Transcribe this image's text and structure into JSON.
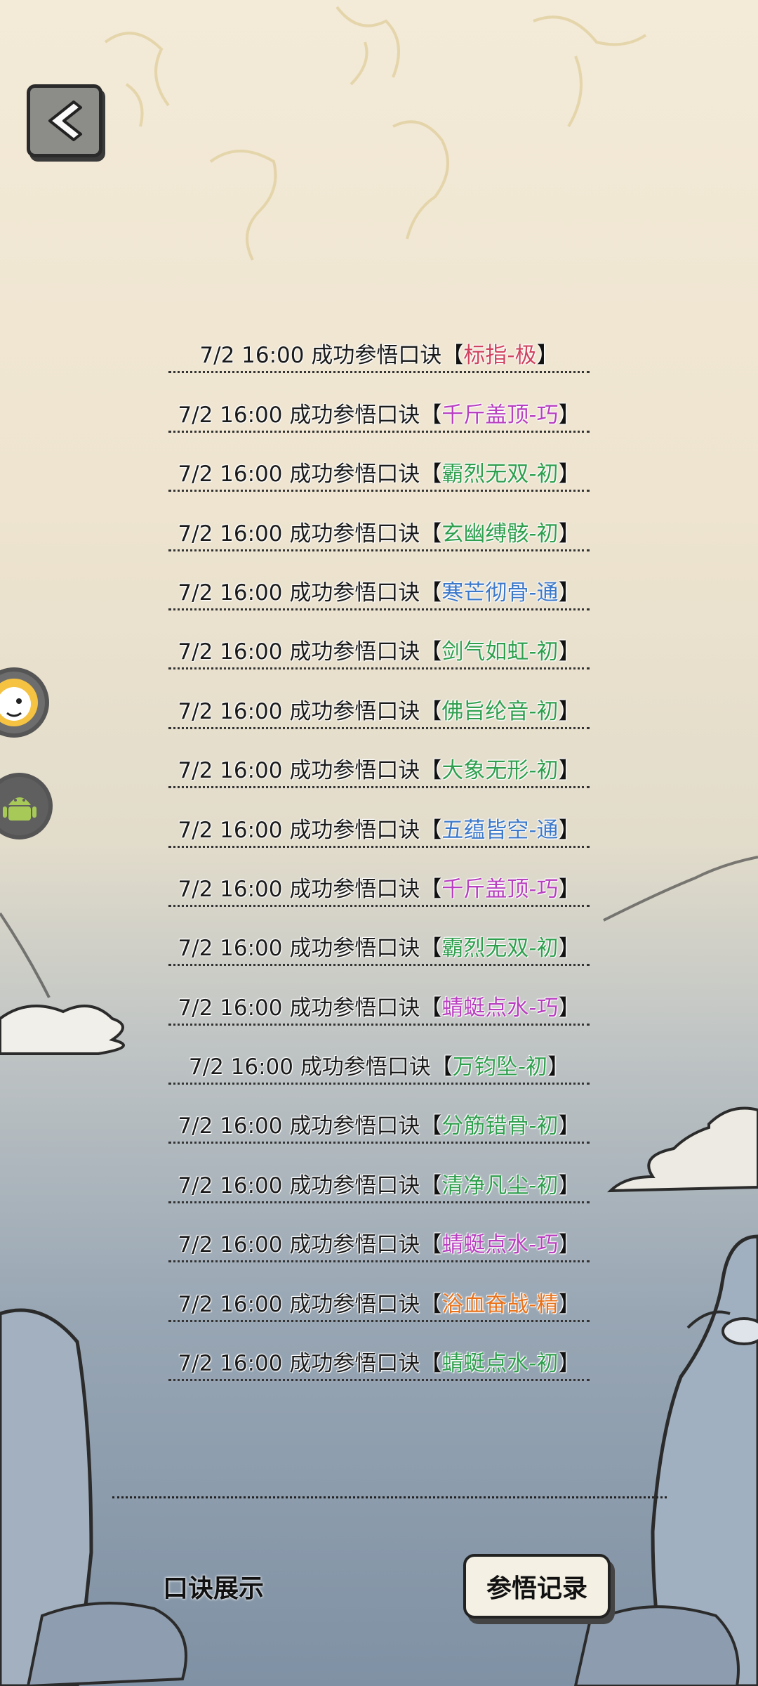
{
  "log_entries": [
    {
      "time": "7/2 16:00",
      "action": "成功参悟口诀",
      "skill": "标指-极",
      "color": "#d0435f"
    },
    {
      "time": "7/2 16:00",
      "action": "成功参悟口诀",
      "skill": "千斤盖顶-巧",
      "color": "#b83fbf"
    },
    {
      "time": "7/2 16:00",
      "action": "成功参悟口诀",
      "skill": "霸烈无双-初",
      "color": "#2f9f4e"
    },
    {
      "time": "7/2 16:00",
      "action": "成功参悟口诀",
      "skill": "玄幽缚骸-初",
      "color": "#2f9f4e"
    },
    {
      "time": "7/2 16:00",
      "action": "成功参悟口诀",
      "skill": "寒芒彻骨-通",
      "color": "#3c78c9"
    },
    {
      "time": "7/2 16:00",
      "action": "成功参悟口诀",
      "skill": "剑气如虹-初",
      "color": "#2f9f4e"
    },
    {
      "time": "7/2 16:00",
      "action": "成功参悟口诀",
      "skill": "佛旨纶音-初",
      "color": "#2f9f4e"
    },
    {
      "time": "7/2 16:00",
      "action": "成功参悟口诀",
      "skill": "大象无形-初",
      "color": "#2f9f4e"
    },
    {
      "time": "7/2 16:00",
      "action": "成功参悟口诀",
      "skill": "五蕴皆空-通",
      "color": "#3c78c9"
    },
    {
      "time": "7/2 16:00",
      "action": "成功参悟口诀",
      "skill": "千斤盖顶-巧",
      "color": "#b83fbf"
    },
    {
      "time": "7/2 16:00",
      "action": "成功参悟口诀",
      "skill": "霸烈无双-初",
      "color": "#2f9f4e"
    },
    {
      "time": "7/2 16:00",
      "action": "成功参悟口诀",
      "skill": "蜻蜓点水-巧",
      "color": "#b83fbf"
    },
    {
      "time": "7/2 16:00",
      "action": "成功参悟口诀",
      "skill": "万钧坠-初",
      "color": "#2f9f4e"
    },
    {
      "time": "7/2 16:00",
      "action": "成功参悟口诀",
      "skill": "分筋错骨-初",
      "color": "#2f9f4e"
    },
    {
      "time": "7/2 16:00",
      "action": "成功参悟口诀",
      "skill": "清净凡尘-初",
      "color": "#2f9f4e"
    },
    {
      "time": "7/2 16:00",
      "action": "成功参悟口诀",
      "skill": "蜻蜓点水-巧",
      "color": "#b83fbf"
    },
    {
      "time": "7/2 16:00",
      "action": "成功参悟口诀",
      "skill": "浴血奋战-精",
      "color": "#e8731c"
    },
    {
      "time": "7/2 16:00",
      "action": "成功参悟口诀",
      "skill": "蜻蜓点水-初",
      "color": "#2f9f4e"
    }
  ],
  "brackets": {
    "open": "【",
    "close": "】"
  },
  "bottom_tabs": {
    "show": "口诀展示",
    "record": "参悟记录"
  },
  "icons": {
    "back": "chevron-left-icon",
    "pet": "pet-avatar-icon",
    "android": "android-icon"
  }
}
